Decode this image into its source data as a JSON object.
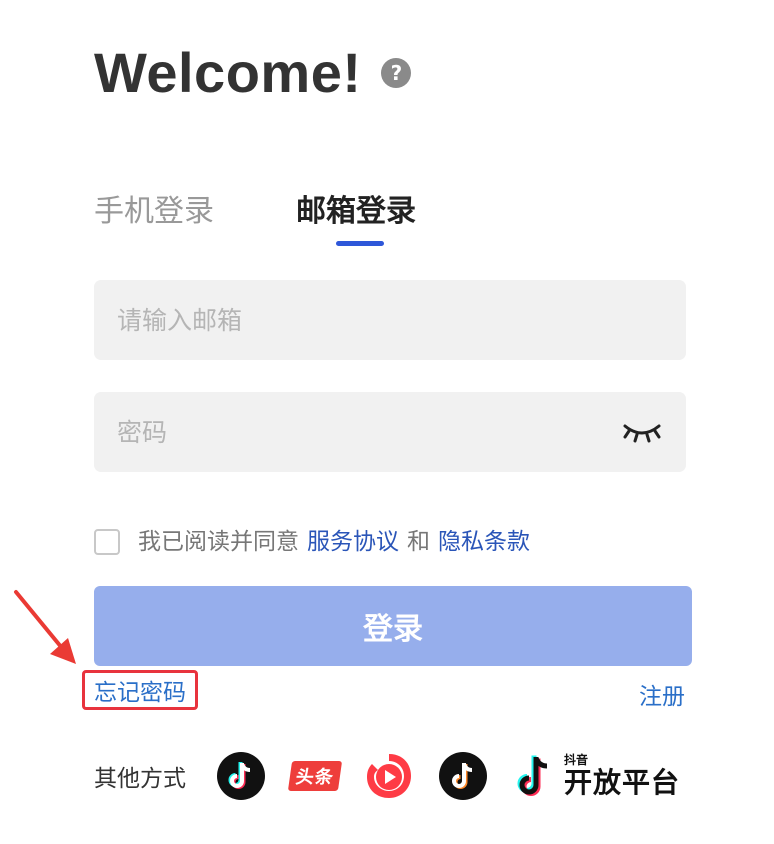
{
  "header": {
    "title": "Welcome!",
    "help_icon_glyph": "?"
  },
  "tabs": [
    {
      "label": "手机登录",
      "active": false
    },
    {
      "label": "邮箱登录",
      "active": true
    }
  ],
  "form": {
    "email": {
      "placeholder": "请输入邮箱",
      "value": ""
    },
    "password": {
      "placeholder": "密码",
      "value": ""
    },
    "password_toggle_icon": "eye-closed-icon"
  },
  "agreement": {
    "checked": false,
    "prefix": "我已阅读并同意",
    "terms_link": "服务协议",
    "and": "和",
    "privacy_link": "隐私条款"
  },
  "login_button": {
    "label": "登录"
  },
  "links": {
    "forgot_password": "忘记密码",
    "register": "注册"
  },
  "other_methods": {
    "label": "其他方式",
    "items": [
      {
        "name": "douyin-icon"
      },
      {
        "name": "toutiao-icon",
        "text": "头条"
      },
      {
        "name": "xigua-video-icon"
      },
      {
        "name": "douyin-huoshan-icon"
      }
    ],
    "open_platform": {
      "small": "抖音",
      "big": "开放平台"
    }
  },
  "colors": {
    "accent": "#2e57d9",
    "login_button_bg": "#96aeec",
    "link": "#2a6fc8",
    "highlight_box": "#e8333d",
    "field_bg": "#f1f1f1"
  }
}
